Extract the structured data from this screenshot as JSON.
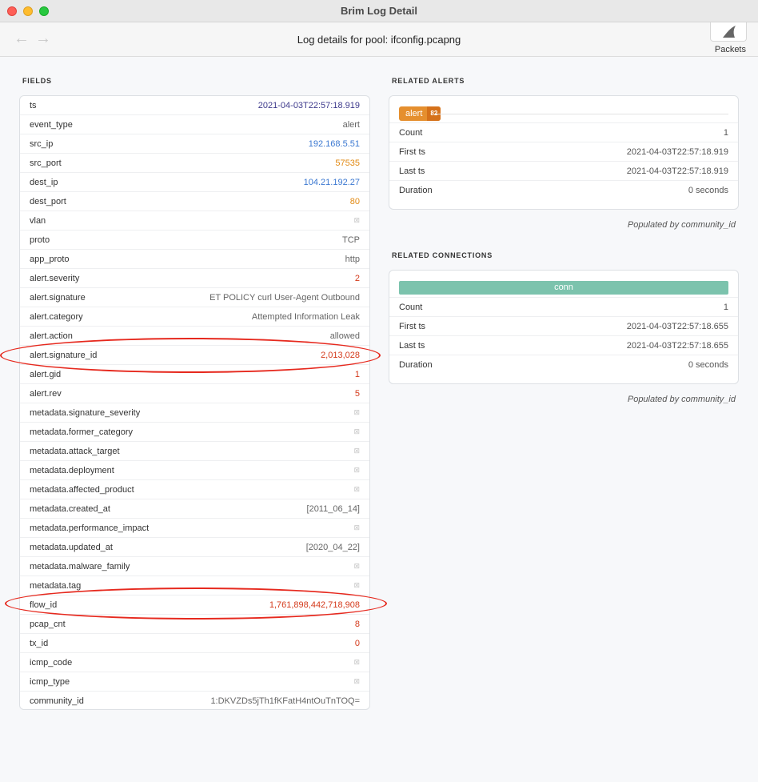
{
  "window": {
    "title": "Brim Log Detail"
  },
  "toolbar": {
    "page_title": "Log details for pool: ifconfig.pcapng",
    "back_glyph": "←",
    "forward_glyph": "→",
    "packets_label": "Packets"
  },
  "fields": {
    "heading": "FIELDS",
    "null_glyph": "⊠",
    "rows": [
      {
        "name": "ts",
        "value": "2021-04-03T22:57:18.919",
        "kind": "time"
      },
      {
        "name": "event_type",
        "value": "alert",
        "kind": "str"
      },
      {
        "name": "src_ip",
        "value": "192.168.5.51",
        "kind": "ip"
      },
      {
        "name": "src_port",
        "value": "57535",
        "kind": "port"
      },
      {
        "name": "dest_ip",
        "value": "104.21.192.27",
        "kind": "ip"
      },
      {
        "name": "dest_port",
        "value": "80",
        "kind": "port"
      },
      {
        "name": "vlan",
        "value": null,
        "kind": "null"
      },
      {
        "name": "proto",
        "value": "TCP",
        "kind": "str"
      },
      {
        "name": "app_proto",
        "value": "http",
        "kind": "str"
      },
      {
        "name": "alert.severity",
        "value": "2",
        "kind": "num"
      },
      {
        "name": "alert.signature",
        "value": "ET POLICY curl User-Agent Outbound",
        "kind": "str"
      },
      {
        "name": "alert.category",
        "value": "Attempted Information Leak",
        "kind": "str"
      },
      {
        "name": "alert.action",
        "value": "allowed",
        "kind": "str"
      },
      {
        "name": "alert.signature_id",
        "value": "2,013,028",
        "kind": "num"
      },
      {
        "name": "alert.gid",
        "value": "1",
        "kind": "num"
      },
      {
        "name": "alert.rev",
        "value": "5",
        "kind": "num"
      },
      {
        "name": "metadata.signature_severity",
        "value": null,
        "kind": "null"
      },
      {
        "name": "metadata.former_category",
        "value": null,
        "kind": "null"
      },
      {
        "name": "metadata.attack_target",
        "value": null,
        "kind": "null"
      },
      {
        "name": "metadata.deployment",
        "value": null,
        "kind": "null"
      },
      {
        "name": "metadata.affected_product",
        "value": null,
        "kind": "null"
      },
      {
        "name": "metadata.created_at",
        "value": "[2011_06_14]",
        "kind": "str"
      },
      {
        "name": "metadata.performance_impact",
        "value": null,
        "kind": "null"
      },
      {
        "name": "metadata.updated_at",
        "value": "[2020_04_22]",
        "kind": "str"
      },
      {
        "name": "metadata.malware_family",
        "value": null,
        "kind": "null"
      },
      {
        "name": "metadata.tag",
        "value": null,
        "kind": "null"
      },
      {
        "name": "flow_id",
        "value": "1,761,898,442,718,908",
        "kind": "num"
      },
      {
        "name": "pcap_cnt",
        "value": "8",
        "kind": "num"
      },
      {
        "name": "tx_id",
        "value": "0",
        "kind": "num"
      },
      {
        "name": "icmp_code",
        "value": null,
        "kind": "null"
      },
      {
        "name": "icmp_type",
        "value": null,
        "kind": "null"
      },
      {
        "name": "community_id",
        "value": "1:DKVZDs5jTh1fKFatH4ntOuTnTOQ=",
        "kind": "str"
      }
    ]
  },
  "related_alerts": {
    "heading": "RELATED ALERTS",
    "badge_label": "alert",
    "badge_count": "82",
    "stats": [
      {
        "label": "Count",
        "value": "1"
      },
      {
        "label": "First ts",
        "value": "2021-04-03T22:57:18.919"
      },
      {
        "label": "Last ts",
        "value": "2021-04-03T22:57:18.919"
      },
      {
        "label": "Duration",
        "value": "0 seconds"
      }
    ],
    "populated_by": "Populated by community_id"
  },
  "related_connections": {
    "heading": "RELATED CONNECTIONS",
    "bar_label": "conn",
    "stats": [
      {
        "label": "Count",
        "value": "1"
      },
      {
        "label": "First ts",
        "value": "2021-04-03T22:57:18.655"
      },
      {
        "label": "Last ts",
        "value": "2021-04-03T22:57:18.655"
      },
      {
        "label": "Duration",
        "value": "0 seconds"
      }
    ],
    "populated_by": "Populated by community_id"
  },
  "colors": {
    "time": "#3e3a8c",
    "ip": "#3b78d1",
    "port": "#e28a14",
    "number": "#d43a1b",
    "alert_badge": "#e58f2e",
    "conn_bar": "#7cc3ad",
    "annotation_ring": "#e6291e"
  },
  "annotations": {
    "highlighted_fields": [
      "alert.signature_id",
      "flow_id"
    ]
  }
}
